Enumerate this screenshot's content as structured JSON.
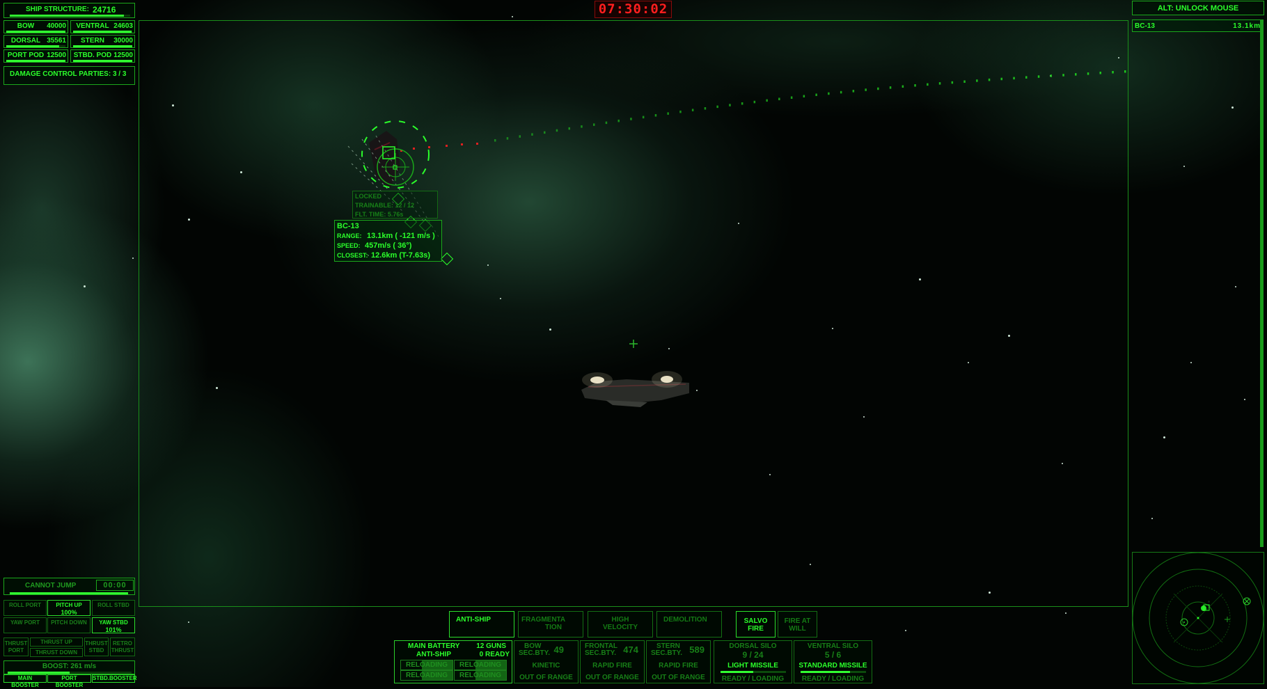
{
  "clock": {
    "time": "07:30:02",
    "color": "#ff1e1e"
  },
  "colors": {
    "hud_green": "#2bff2b",
    "hud_dim": "#1c8f1c",
    "enemy_red": "#ff1e1e"
  },
  "ship_status": {
    "structure_label": "SHIP STRUCTURE:",
    "structure_value": "24716",
    "structure_fraction": 0.95,
    "sections": [
      {
        "label": "BOW",
        "value": "40000",
        "fraction": 1.0
      },
      {
        "label": "VENTRAL",
        "value": "24603",
        "fraction": 0.99
      },
      {
        "label": "DORSAL",
        "value": "35561",
        "fraction": 0.89
      },
      {
        "label": "STERN",
        "value": "30000",
        "fraction": 1.0
      },
      {
        "label": "PORT POD",
        "value": "12500",
        "fraction": 1.0
      },
      {
        "label": "STBD. POD",
        "value": "12500",
        "fraction": 1.0
      }
    ],
    "damage_control": "DAMAGE CONTROL PARTIES: 3 / 3"
  },
  "top_right": {
    "unlock_hint": "ALT: UNLOCK MOUSE",
    "target_list": [
      {
        "name": "BC-13",
        "distance": "13.1km"
      }
    ]
  },
  "target_lock": {
    "status": "LOCKED",
    "trainable": "TRAINABLE: 12 / 12",
    "flight_time": "FLT. TIME: 5.76s"
  },
  "target_info": {
    "name": "BC-13",
    "range_label": "RANGE:",
    "range_value": "13.1km ( -121  m/s  )",
    "speed_label": "SPEED:",
    "speed_value": "457m/s (  36°)",
    "closest_label": "CLOSEST:",
    "closest_value": "12.6km (T-7.63s)"
  },
  "jump": {
    "label": "CANNOT JUMP",
    "timer": "00:00",
    "fraction": 1.0
  },
  "maneuver": {
    "roll_port": "ROLL PORT",
    "pitch_up": "PITCH UP",
    "pitch_up_value": "100%",
    "roll_stbd": "ROLL STBD",
    "yaw_port": "YAW PORT",
    "pitch_down": "PITCH DOWN",
    "yaw_stbd": "YAW STBD",
    "yaw_stbd_value": "101%",
    "thrust_port_1": "THRUST",
    "thrust_port_2": "PORT",
    "thrust_up": "THRUST UP",
    "thrust_down": "THRUST DOWN",
    "thrust_stbd_1": "THRUST",
    "thrust_stbd_2": "STBD",
    "retro_1": "RETRO",
    "retro_2": "THRUST"
  },
  "boost": {
    "label": "BOOST: 261 m/s",
    "fraction": 0.5,
    "main_booster": "MAIN BOOSTER",
    "port_booster": "PORT BOOSTER",
    "stbd_booster": "STBD.BOOSTER"
  },
  "ammo_modes": [
    {
      "line1": "ANTI-SHIP",
      "line2": "",
      "active": true
    },
    {
      "line1": "FRAGMENTA",
      "line2": "TION",
      "active": false
    },
    {
      "line1": "HIGH",
      "line2": "VELOCITY",
      "active": false
    },
    {
      "line1": "DEMOLITION",
      "line2": "",
      "active": false
    }
  ],
  "fire_modes": [
    {
      "line1": "SALVO",
      "line2": "FIRE",
      "active": true
    },
    {
      "line1": "FIRE AT",
      "line2": "WILL",
      "active": false
    }
  ],
  "main_battery": {
    "title": "MAIN BATTERY",
    "guns": "12 GUNS",
    "ammo": "ANTI-SHIP",
    "ready": "0 READY",
    "turrets": [
      {
        "label": "RELOADING",
        "progress": 0.6
      },
      {
        "label": "RELOADING",
        "progress": 0.6
      },
      {
        "label": "RELOADING",
        "progress": 0.6
      },
      {
        "label": "RELOADING",
        "progress": 0.6
      }
    ]
  },
  "secondary_batteries": [
    {
      "line1": "BOW",
      "line2": "SEC.BTY.",
      "count": "49",
      "type": "KINETIC",
      "status": "OUT OF RANGE"
    },
    {
      "line1": "FRONTAL",
      "line2": "SEC.BTY.",
      "count": "474",
      "type": "RAPID FIRE",
      "status": "OUT OF RANGE"
    },
    {
      "line1": "STERN",
      "line2": "SEC.BTY.",
      "count": "589",
      "type": "RAPID FIRE",
      "status": "OUT OF RANGE"
    }
  ],
  "silos": [
    {
      "title": "DORSAL SILO",
      "count": "9 / 24",
      "missile": "LIGHT MISSILE",
      "progress": 0.5,
      "status": "READY / LOADING"
    },
    {
      "title": "VENTRAL SILO",
      "count": "5 / 6",
      "missile": "STANDARD MISSILE",
      "progress": 0.75,
      "status": "READY / LOADING"
    }
  ]
}
